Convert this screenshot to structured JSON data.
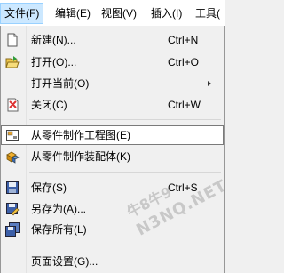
{
  "menubar": {
    "items": [
      {
        "label": "文件(F)"
      },
      {
        "label": "编辑(E)"
      },
      {
        "label": "视图(V)"
      },
      {
        "label": "插入(I)"
      },
      {
        "label": "工具("
      }
    ]
  },
  "file_menu": {
    "items": [
      {
        "label": "新建(N)...",
        "shortcut": "Ctrl+N",
        "icon": "new-document-icon"
      },
      {
        "label": "打开(O)...",
        "shortcut": "Ctrl+O",
        "icon": "open-folder-icon"
      },
      {
        "label": "打开当前(O)",
        "shortcut": "",
        "icon": "",
        "submenu": true
      },
      {
        "label": "关闭(C)",
        "shortcut": "Ctrl+W",
        "icon": "close-document-icon"
      },
      {
        "label": "从零件制作工程图(E)",
        "shortcut": "",
        "icon": "make-drawing-icon",
        "highlighted": true
      },
      {
        "label": "从零件制作装配体(K)",
        "shortcut": "",
        "icon": "make-assembly-icon"
      },
      {
        "label": "保存(S)",
        "shortcut": "Ctrl+S",
        "icon": "save-icon"
      },
      {
        "label": "另存为(A)...",
        "shortcut": "",
        "icon": "save-as-icon"
      },
      {
        "label": "保存所有(L)",
        "shortcut": "",
        "icon": "save-all-icon"
      },
      {
        "label": "页面设置(G)...",
        "shortcut": "",
        "icon": ""
      }
    ]
  },
  "watermark": {
    "line1": "牛8牛9",
    "line2": "N3NQ.NET"
  },
  "colors": {
    "menu_bg": "#f0f0f0",
    "active_menubar_bg": "#cce8ff",
    "highlight_border": "#7a7a7a"
  }
}
